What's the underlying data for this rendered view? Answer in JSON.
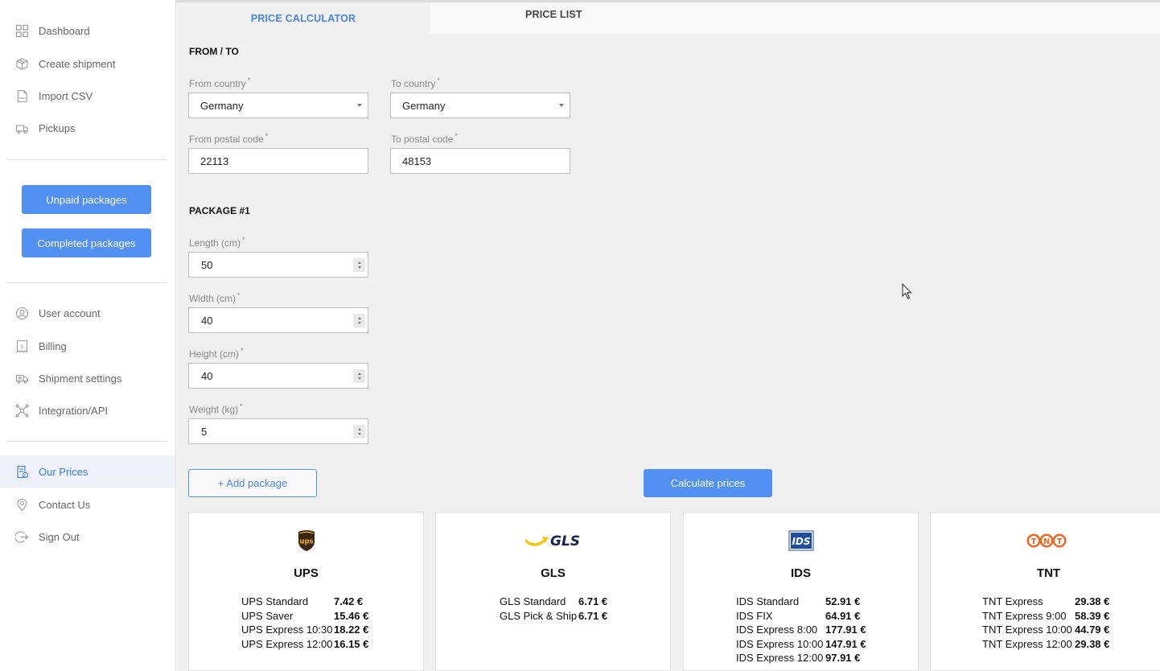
{
  "sidebar": {
    "nav_top": [
      {
        "label": "Dashboard",
        "icon": "dashboard-icon"
      },
      {
        "label": "Create shipment",
        "icon": "box-icon"
      },
      {
        "label": "Import CSV",
        "icon": "csv-file-icon"
      },
      {
        "label": "Pickups",
        "icon": "truck-icon"
      }
    ],
    "buttons": {
      "unpaid": "Unpaid packages",
      "completed": "Completed packages"
    },
    "nav_account": [
      {
        "label": "User account",
        "icon": "user-icon"
      },
      {
        "label": "Billing",
        "icon": "invoice-icon"
      },
      {
        "label": "Shipment settings",
        "icon": "truck-settings-icon"
      },
      {
        "label": "Integration/API",
        "icon": "network-icon"
      }
    ],
    "nav_bottom": [
      {
        "label": "Our Prices",
        "icon": "price-list-icon",
        "active": true
      },
      {
        "label": "Contact Us",
        "icon": "location-pin-icon"
      },
      {
        "label": "Sign Out",
        "icon": "sign-out-icon"
      }
    ]
  },
  "tabs": {
    "calculator": "PRICE CALCULATOR",
    "price_list": "PRICE LIST",
    "active": "calculator"
  },
  "route": {
    "title": "FROM / TO",
    "from_country_label": "From country",
    "from_country": "Germany",
    "to_country_label": "To country",
    "to_country": "Germany",
    "from_postal_label": "From postal code",
    "from_postal": "22113",
    "to_postal_label": "To postal code",
    "to_postal": "48153",
    "required_mark": "*"
  },
  "package": {
    "title": "PACKAGE #1",
    "length_label": "Length (cm)",
    "length": "50",
    "width_label": "Width (cm)",
    "width": "40",
    "height_label": "Height (cm)",
    "height": "40",
    "weight_label": "Weight (kg)",
    "weight": "5"
  },
  "actions": {
    "add_package": "+ Add package",
    "calculate": "Calculate prices"
  },
  "carriers": [
    {
      "name": "UPS",
      "logo": "ups-logo-icon",
      "services": [
        {
          "name": "UPS Standard",
          "price": "7.42 €"
        },
        {
          "name": "UPS Saver",
          "price": "15.46 €"
        },
        {
          "name": "UPS Express 10:30",
          "price": "18.22 €"
        },
        {
          "name": "UPS Express 12:00",
          "price": "16.15 €"
        }
      ]
    },
    {
      "name": "GLS",
      "logo": "gls-logo-icon",
      "logo_text": "GLS",
      "services": [
        {
          "name": "GLS Standard",
          "price": "6.71 €"
        },
        {
          "name": "GLS Pick & Ship",
          "price": "6.71 €"
        }
      ]
    },
    {
      "name": "IDS",
      "logo": "ids-logo-icon",
      "logo_text": "IDS",
      "services": [
        {
          "name": "IDS Standard",
          "price": "52.91 €"
        },
        {
          "name": "IDS FIX",
          "price": "64.91 €"
        },
        {
          "name": "IDS Express 8:00",
          "price": "177.91 €"
        },
        {
          "name": "IDS Express 10:00",
          "price": "147.91 €"
        },
        {
          "name": "IDS Express 12:00",
          "price": "97.91 €"
        }
      ]
    },
    {
      "name": "TNT",
      "logo": "tnt-logo-icon",
      "logo_text": "TNT",
      "services": [
        {
          "name": "TNT Express",
          "price": "29.38 €"
        },
        {
          "name": "TNT Express 9:00",
          "price": "58.39 €"
        },
        {
          "name": "TNT Express 10:00",
          "price": "44.79 €"
        },
        {
          "name": "TNT Express 12:00",
          "price": "29.38 €"
        }
      ]
    }
  ],
  "colors": {
    "accent": "#5091f3",
    "active_text": "#3b7bdc",
    "ups_brown": "#3b2516",
    "ups_gold": "#f5b50e",
    "gls_blue": "#172154",
    "gls_yellow": "#f6c400",
    "ids_blue": "#1d4f9c",
    "tnt_orange": "#f26522"
  }
}
